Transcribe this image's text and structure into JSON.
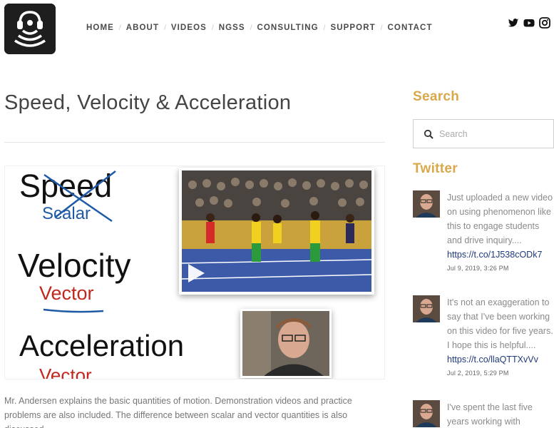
{
  "nav": {
    "items": [
      "HOME",
      "ABOUT",
      "VIDEOS",
      "NGSS",
      "CONSULTING",
      "SUPPORT",
      "CONTACT"
    ],
    "separator": "/"
  },
  "social": [
    "twitter-icon",
    "youtube-icon",
    "instagram-icon"
  ],
  "main": {
    "title": "Speed, Velocity & Acceleration",
    "video": {
      "word1": "Speed",
      "word1_sub": "Scalar",
      "word2": "Velocity",
      "word2_sub": "Vector",
      "word3": "Acceleration",
      "word3_sub": "Vector"
    },
    "description": "Mr. Andersen explains the basic quantities of motion. Demonstration videos and practice problems are also included. The difference between scalar and vector quantities is also discussed."
  },
  "sidebar": {
    "search_heading": "Search",
    "search_placeholder": "Search",
    "twitter_heading": "Twitter",
    "tweets": [
      {
        "text": "Just uploaded a new video on using phenomenon like this to engage students and drive inquiry....",
        "link": "https://t.co/1J538cODk7",
        "date": "Jul 9, 2019, 3:26 PM"
      },
      {
        "text": "It's not an exaggeration to say that I've been working on this video for five years. I hope this is helpful....",
        "link": "https://t.co/llaQTTXvVv",
        "date": "Jul 2, 2019, 5:29 PM"
      },
      {
        "text": "I've spent the last five years working with",
        "link": "",
        "date": ""
      }
    ]
  },
  "colors": {
    "accent": "#d8a84a",
    "link": "#1f3a7a",
    "vector_red": "#c0281e",
    "scalar_blue": "#1f5aa6"
  }
}
